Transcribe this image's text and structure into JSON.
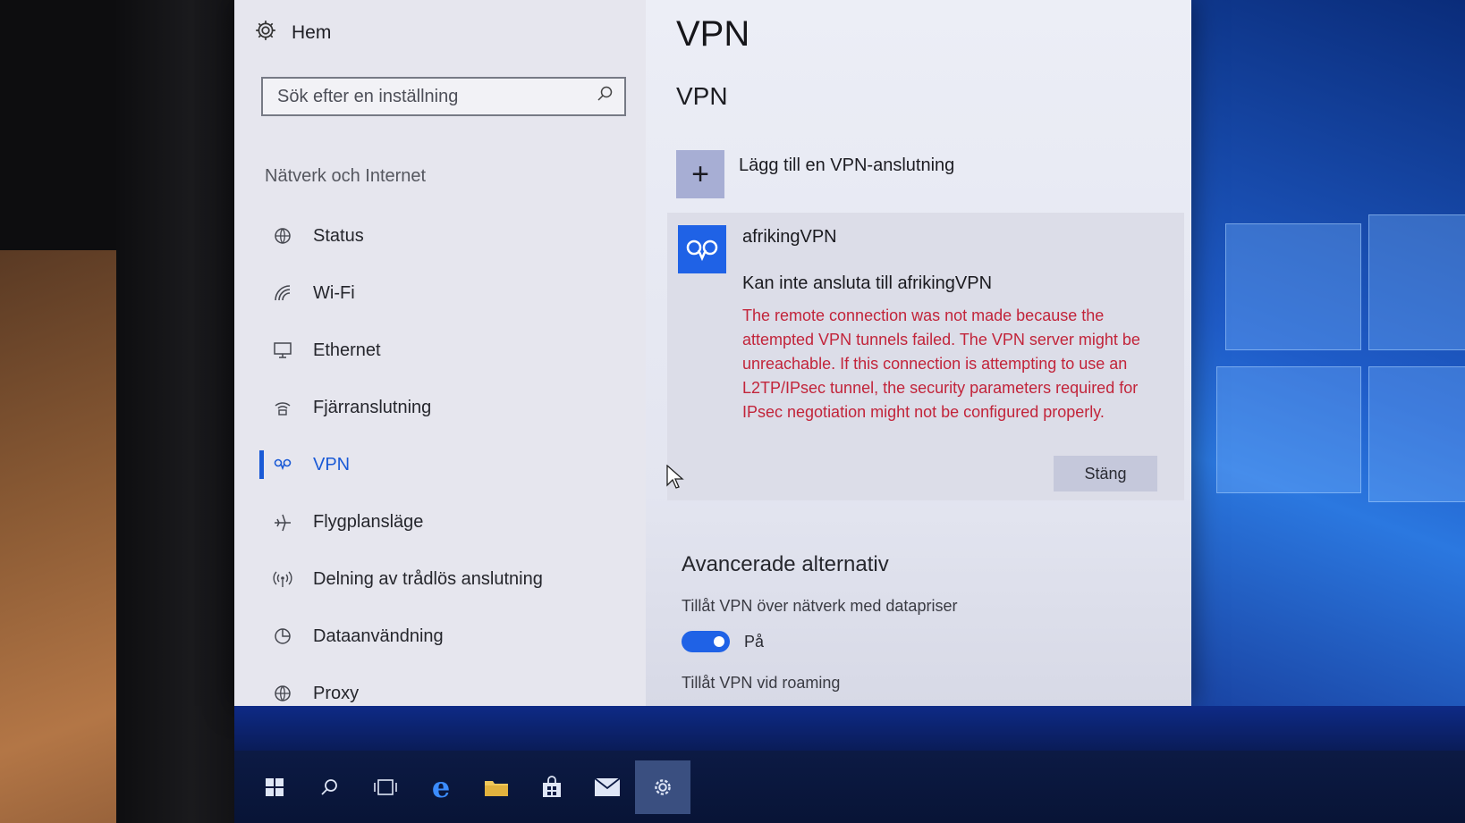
{
  "window": {
    "home_label": "Hem",
    "search_placeholder": "Sök efter en inställning",
    "section_label": "Nätverk och Internet"
  },
  "nav": {
    "items": [
      {
        "label": "Status",
        "icon": "globe-status-icon"
      },
      {
        "label": "Wi-Fi",
        "icon": "wifi-icon"
      },
      {
        "label": "Ethernet",
        "icon": "ethernet-icon"
      },
      {
        "label": "Fjärranslutning",
        "icon": "dialup-icon"
      },
      {
        "label": "VPN",
        "icon": "vpn-icon"
      },
      {
        "label": "Flygplansläge",
        "icon": "airplane-icon"
      },
      {
        "label": "Delning av trådlös anslutning",
        "icon": "hotspot-icon"
      },
      {
        "label": "Dataanvändning",
        "icon": "data-usage-icon"
      },
      {
        "label": "Proxy",
        "icon": "proxy-globe-icon"
      }
    ],
    "active_index": 4
  },
  "main": {
    "page_title": "VPN",
    "sub_title": "VPN",
    "add_vpn_label": "Lägg till en VPN-anslutning",
    "vpn_connection": {
      "name": "afrikingVPN",
      "status": "Kan inte ansluta till afrikingVPN",
      "error_lines": [
        "The remote connection was not made because the",
        "attempted VPN tunnels failed. The VPN server might be",
        "unreachable. If this connection is attempting to use an",
        "L2TP/IPsec tunnel, the security parameters required for",
        "IPsec negotiation might not be configured properly."
      ],
      "close_button": "Stäng"
    },
    "advanced": {
      "title": "Avancerade alternativ",
      "metered_label": "Tillåt VPN över nätverk med datapriser",
      "metered_toggle_state": "På",
      "roaming_label": "Tillåt VPN vid roaming"
    }
  },
  "colors": {
    "accent": "#1f62e6",
    "error": "#c2243a"
  },
  "taskbar": {
    "items": [
      "windows-start-icon",
      "search-icon",
      "task-view-icon",
      "edge-icon",
      "file-explorer-icon",
      "store-icon",
      "mail-icon",
      "settings-gear-icon"
    ],
    "active": "settings-gear-icon"
  }
}
